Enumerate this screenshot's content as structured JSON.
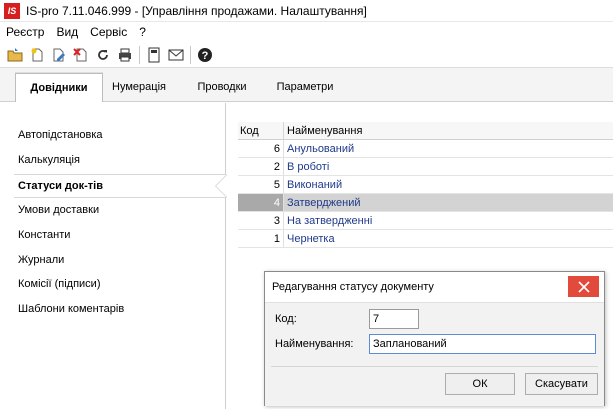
{
  "window": {
    "logo_text": "IS",
    "title": "IS-pro 7.11.046.999 - [Управління продажами. Налаштування]"
  },
  "menu": [
    "Реєстр",
    "Вид",
    "Сервіс",
    "?"
  ],
  "toolbar": {
    "icons": [
      "open-folder-icon",
      "new-document-icon",
      "edit-document-icon",
      "delete-document-icon",
      "refresh-icon",
      "print-icon",
      "calculator-icon",
      "mail-icon",
      "help-icon"
    ]
  },
  "tabs": [
    {
      "label": "Довідники",
      "active": true
    },
    {
      "label": "Нумерація",
      "active": false
    },
    {
      "label": "Проводки",
      "active": false
    },
    {
      "label": "Параметри",
      "active": false
    }
  ],
  "sidebar": {
    "items": [
      {
        "label": "Автопідстановка"
      },
      {
        "label": "Калькуляція"
      },
      {
        "label": "Статуси док-тів",
        "active": true
      },
      {
        "label": "Умови доставки"
      },
      {
        "label": "Константи"
      },
      {
        "label": "Журнали"
      },
      {
        "label": "Комісії (підписи)"
      },
      {
        "label": "Шаблони коментарів"
      }
    ]
  },
  "grid": {
    "columns": [
      "Код",
      "Найменування"
    ],
    "rows": [
      {
        "code": "6",
        "name": "Анульований"
      },
      {
        "code": "2",
        "name": "В роботі"
      },
      {
        "code": "5",
        "name": "Виконаний"
      },
      {
        "code": "4",
        "name": "Затверджений",
        "selected": true
      },
      {
        "code": "3",
        "name": "На затвердженні"
      },
      {
        "code": "1",
        "name": "Чернетка"
      }
    ]
  },
  "dialog": {
    "title": "Редагування статусу документу",
    "code_label": "Код:",
    "code_value": "7",
    "name_label": "Найменування:",
    "name_value": "Запланований",
    "ok_label": "ОК",
    "cancel_label": "Скасувати"
  },
  "colors": {
    "logo_red": "#d71e1e",
    "grid_text_blue": "#1f3a8a",
    "close_button_red": "#e24b3c",
    "selection_gray": "#d3d3d3"
  }
}
